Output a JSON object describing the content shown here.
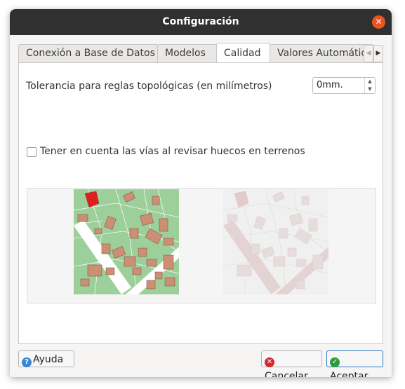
{
  "window": {
    "title": "Configuración",
    "close_glyph": "✕"
  },
  "tabs": [
    {
      "label": "Conexión a Base de Datos"
    },
    {
      "label": "Modelos"
    },
    {
      "label": "Calidad",
      "active": true
    },
    {
      "label": "Valores Automátic"
    }
  ],
  "tab_scroll": {
    "left_glyph": "◀",
    "right_glyph": "▶"
  },
  "quality": {
    "tolerance_label": "Tolerancia para reglas topológicas (en milímetros)",
    "tolerance_value": "0mm.",
    "roads_checkbox_label": "Tener en cuenta las vías al revisar huecos en terrenos",
    "roads_checkbox_checked": false
  },
  "buttons": {
    "help": "Ayuda",
    "cancel": "Cancelar",
    "accept": "Aceptar"
  },
  "icons": {
    "help": "question-icon",
    "cancel": "cancel-icon",
    "accept": "check-icon"
  },
  "colors": {
    "titlebar": "#303030",
    "close": "#e95420",
    "help_icon": "#3a86d6",
    "cancel_icon": "#d9272b",
    "accept_icon": "#2f9c3c",
    "accent_border": "#2a76c6"
  }
}
